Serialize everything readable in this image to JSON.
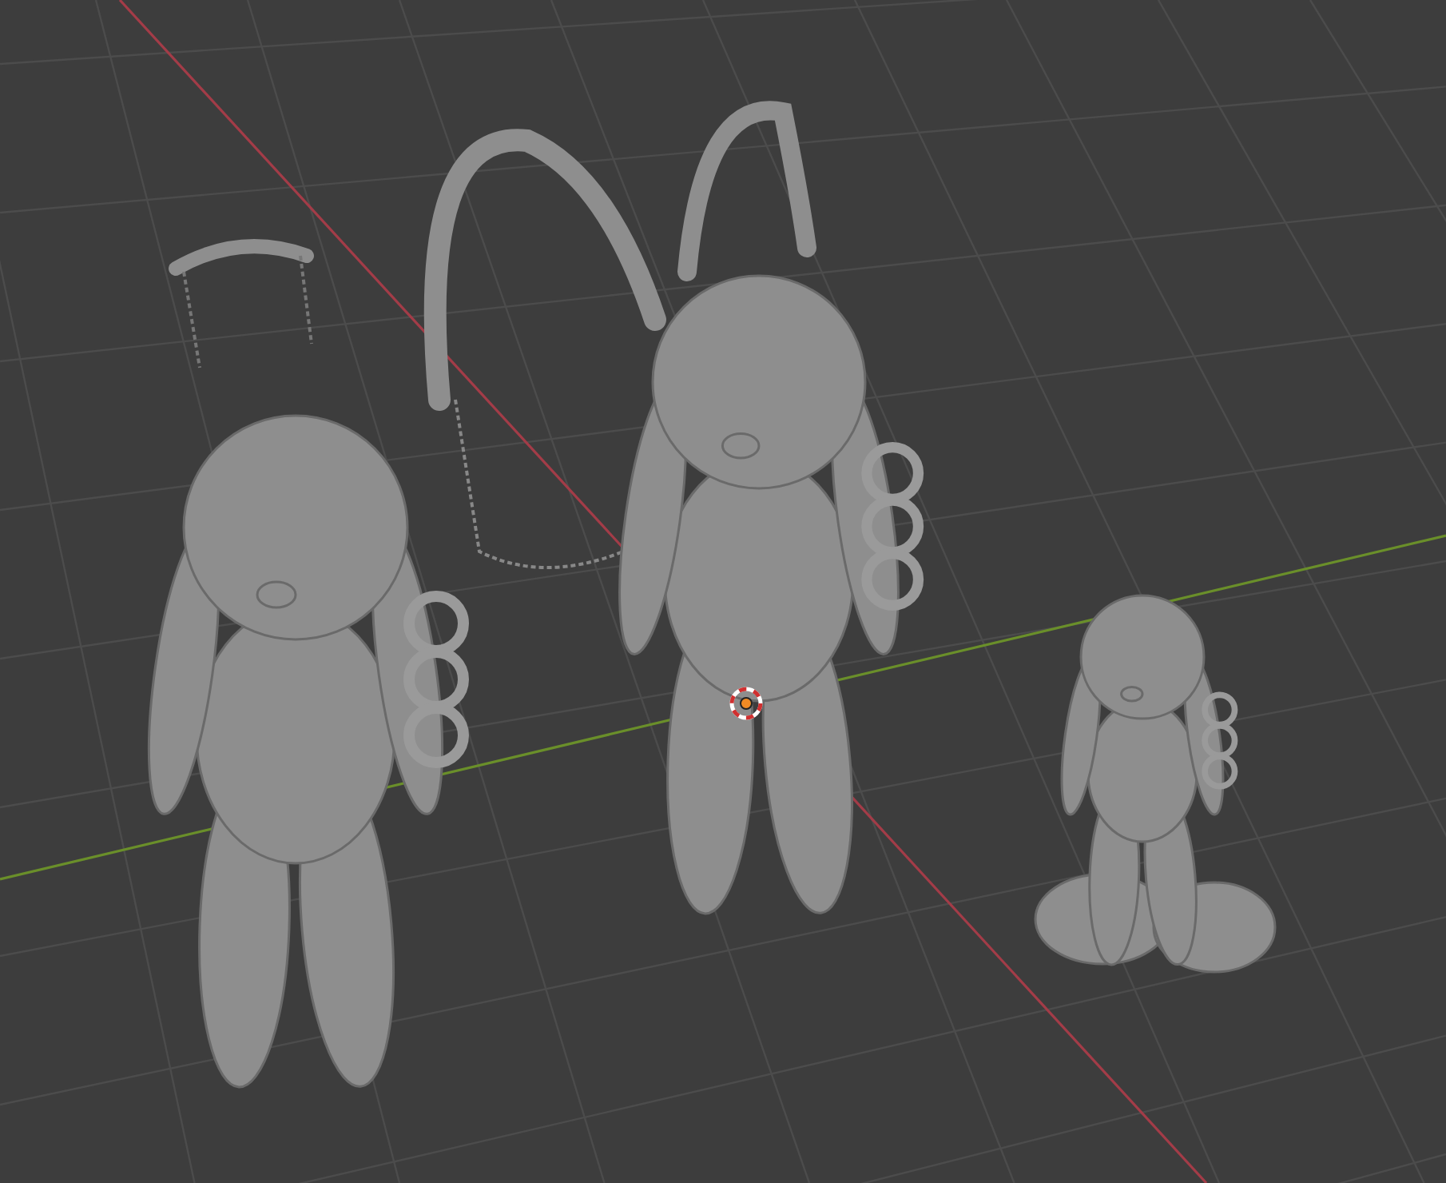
{
  "viewport": {
    "grid": true,
    "axes": [
      {
        "kind": "x",
        "color": "#a33c48"
      },
      {
        "kind": "y",
        "color": "#6a8f2a"
      }
    ],
    "cursor": true
  }
}
